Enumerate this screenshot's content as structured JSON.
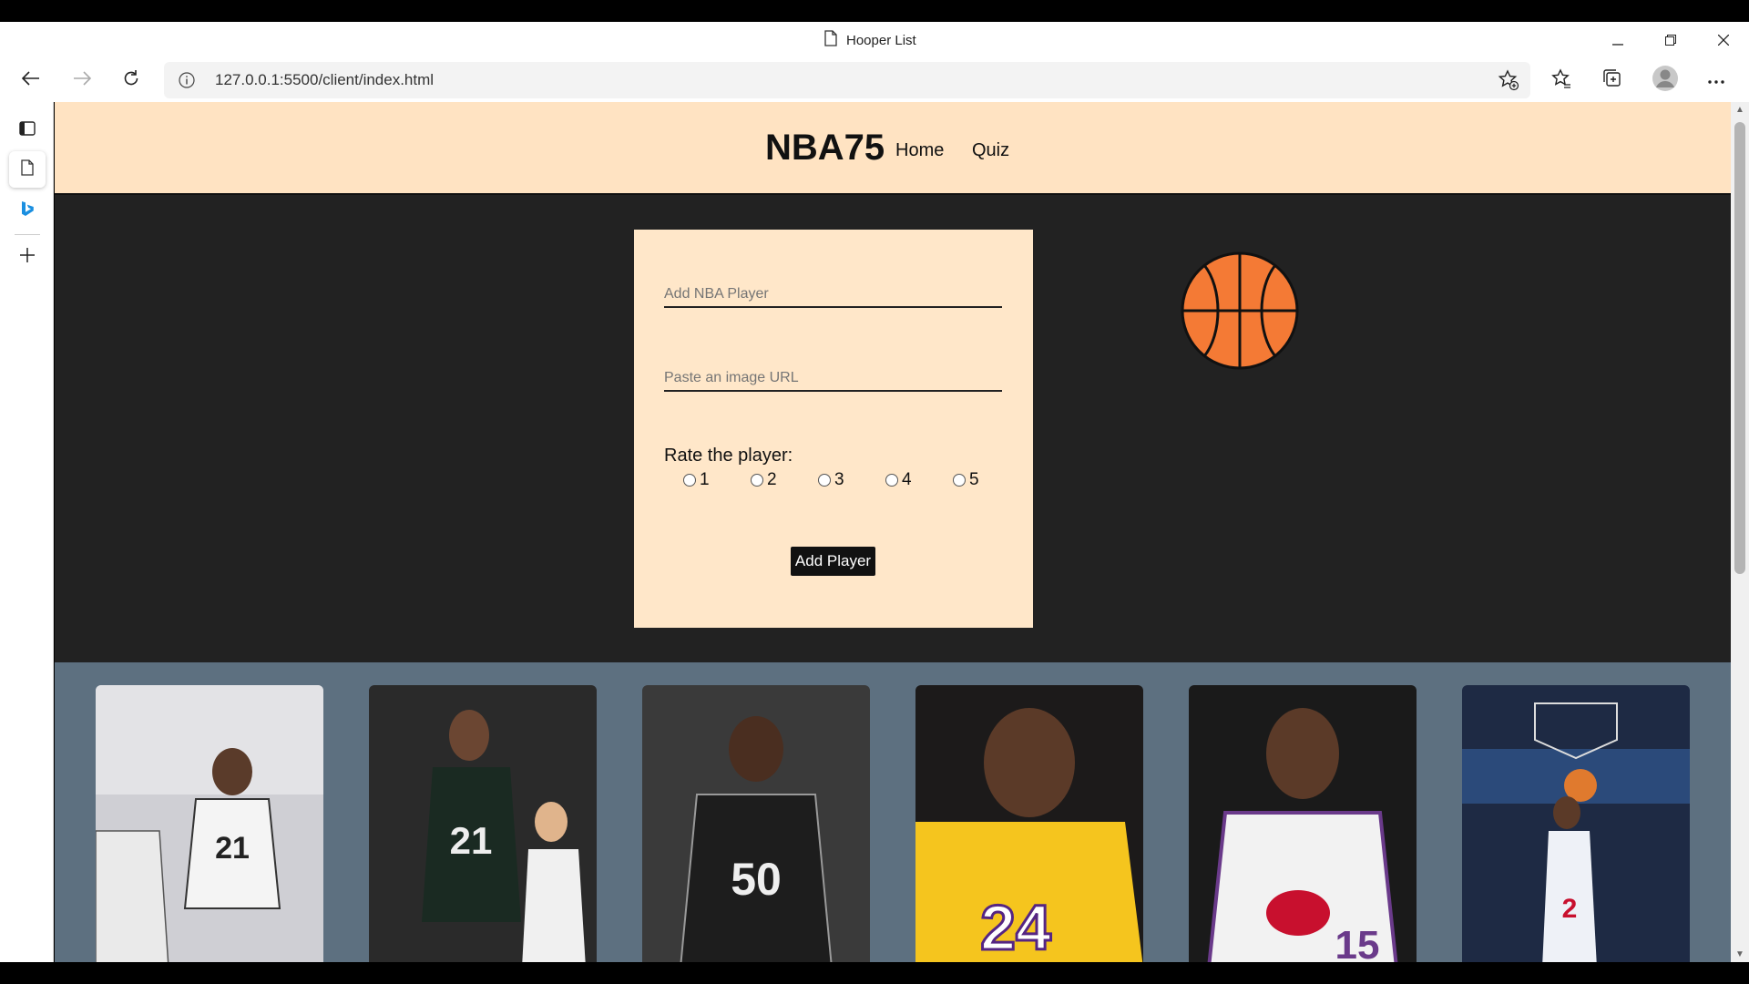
{
  "window": {
    "title": "Hooper List",
    "minimize_icon": "minimize-icon",
    "restore_icon": "restore-icon",
    "close_icon": "close-icon"
  },
  "browser": {
    "url": "127.0.0.1:5500/client/index.html"
  },
  "site": {
    "brand": "NBA75",
    "nav": [
      {
        "label": "Home"
      },
      {
        "label": "Quiz"
      }
    ]
  },
  "form": {
    "player_placeholder": "Add NBA Player",
    "image_placeholder": "Paste an image URL",
    "rate_label": "Rate the player:",
    "ratings": [
      "1",
      "2",
      "3",
      "4",
      "5"
    ],
    "submit_label": "Add Player"
  },
  "colors": {
    "header_bg": "#ffe3c2",
    "card_bg": "#ffe7c9",
    "page_bg": "#222222",
    "band_bg": "#5d7080",
    "ball": "#f47a35"
  },
  "player_cards": [
    {
      "jersey": "21",
      "team_color": "#dcdcdc"
    },
    {
      "jersey": "21",
      "team_color": "#1a2a22"
    },
    {
      "jersey": "50",
      "team_color": "#1d1d1d"
    },
    {
      "jersey": "24",
      "team_color": "#f5c51e"
    },
    {
      "jersey": "15",
      "team_color": "#f2f2f2"
    },
    {
      "jersey": "2",
      "team_color": "#eef1f7"
    }
  ]
}
